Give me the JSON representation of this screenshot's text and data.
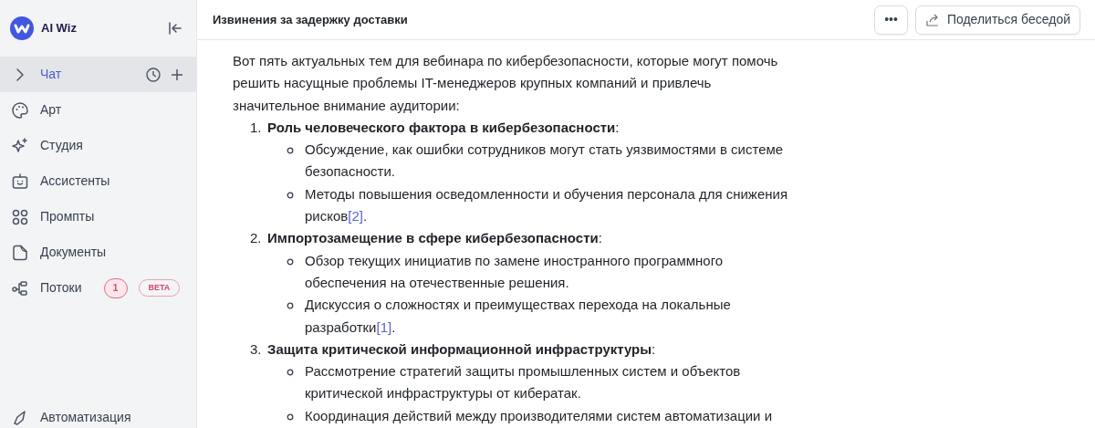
{
  "app": {
    "name": "AI Wiz"
  },
  "sidebar": {
    "items": [
      {
        "label": "Чат",
        "selected": true,
        "expanded": false
      },
      {
        "label": "Арт",
        "selected": false
      },
      {
        "label": "Студия",
        "selected": false
      },
      {
        "label": "Ассистенты",
        "selected": false
      },
      {
        "label": "Промпты",
        "selected": false
      },
      {
        "label": "Документы",
        "selected": false
      },
      {
        "label": "Потоки",
        "selected": false,
        "count": "1",
        "tag": "BETA"
      }
    ],
    "bottom_item": {
      "label": "Автоматизация"
    }
  },
  "header": {
    "title": "Извинения за задержку доставки",
    "more": "•••",
    "share": "Поделиться беседой"
  },
  "message": {
    "intro": "Вот пять актуальных тем для вебинара по кибербезопасности, которые могут помочь решить насущные проблемы IT-менеджеров крупных компаний и привлечь значительное внимание аудитории:",
    "topics": [
      {
        "number": "1.",
        "title": "**Роль человеческого фактора в кибербезопасности**:",
        "points": [
          {
            "text": "Обсуждение, как ошибки сотрудников могут стать уязвимостями в системе безопасности."
          },
          {
            "text": "Методы повышения осведомленности и обучения персонала для снижения рисков",
            "citation": "[2]",
            "end": "."
          }
        ]
      },
      {
        "number": "2.",
        "title": "**Импортозамещение в сфере кибербезопасности**:",
        "points": [
          {
            "text": "Обзор текущих инициатив по замене иностранного программного обеспечения на отечественные решения."
          },
          {
            "text": "Дискуссия о сложностях и преимуществах перехода на локальные разработки",
            "citation": "[1]",
            "end": "."
          }
        ]
      },
      {
        "number": "3.",
        "title": "**Защита критической информационной инфраструктуры**:",
        "points": [
          {
            "text": "Рассмотрение стратегий защиты промышленных систем и объектов критической инфраструктуры от кибератак."
          },
          {
            "text": "Координация действий между производителями систем автоматизации и"
          }
        ]
      }
    ]
  }
}
